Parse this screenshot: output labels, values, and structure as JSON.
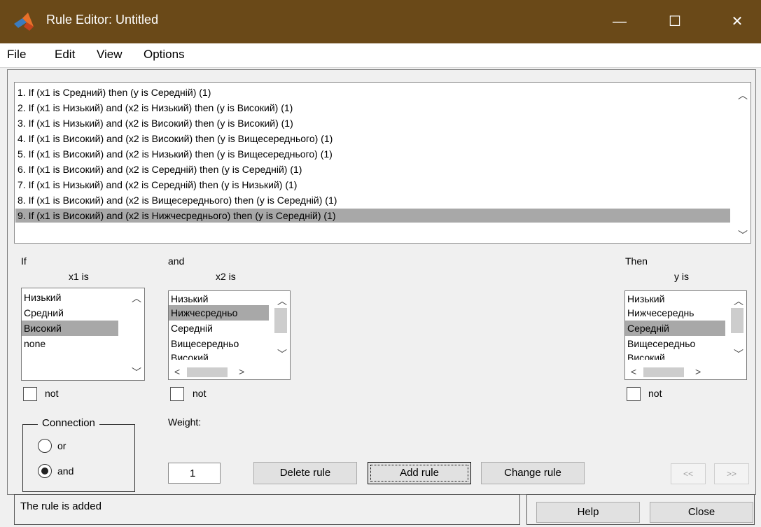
{
  "window": {
    "title": "Rule Editor: Untitled",
    "controls": [
      "—",
      "☐",
      "✕"
    ]
  },
  "menu": [
    "File",
    "Edit",
    "View",
    "Options"
  ],
  "rules": [
    "1. If (x1 is Средний) then (y is Середній) (1)",
    "2. If (x1 is Низький) and (x2 is Низький) then (y is Високий) (1)",
    "3. If (x1 is Низький) and (x2 is Високий) then (y is Високий) (1)",
    "4. If (x1 is Високий) and (x2 is Високий) then (y is Вищесереднього) (1)",
    "5. If (x1 is Високий) and (x2 is Низький) then (y is Вищесереднього) (1)",
    "6. If (x1 is Високий) and (x2 is Середній) then (y is Середній) (1)",
    "7. If (x1 is Низький) and (x2 is Середній) then (y is Низький) (1)",
    "8. If (x1 is Високий) and (x2 is Вищесереднього) then (y is Середній) (1)",
    "9. If (x1 is Високий) and (x2 is Нижчесреднього) then (y is Середній) (1)"
  ],
  "selected_rule_index": 8,
  "if_section": {
    "label": "If",
    "var_label": "x1 is",
    "items": [
      "Низький",
      "Средний",
      "Високий",
      "none"
    ],
    "selected_index": 2,
    "not_label": "not"
  },
  "and_section": {
    "label": "and",
    "var_label": "x2 is",
    "items": [
      "Низький",
      "Нижчесредньо",
      "Середній",
      "Вищесередньо",
      "Високий"
    ],
    "selected_index": 1,
    "not_label": "not"
  },
  "then_section": {
    "label": "Then",
    "var_label": "y is",
    "items": [
      "Низький",
      "Нижчесереднь",
      "Середній",
      "Вищесередньо",
      "Високий"
    ],
    "selected_index": 2,
    "not_label": "not"
  },
  "connection": {
    "title": "Connection",
    "options": [
      "or",
      "and"
    ],
    "selected": "and"
  },
  "weight": {
    "label": "Weight:",
    "value": "1"
  },
  "buttons": {
    "delete": "Delete rule",
    "add": "Add rule",
    "change": "Change rule",
    "prev": "<<",
    "next": ">>",
    "help": "Help",
    "close": "Close"
  },
  "status": "The rule is added"
}
